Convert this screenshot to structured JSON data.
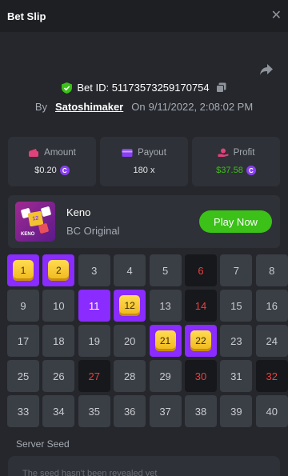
{
  "header": {
    "title": "Bet Slip",
    "close_icon": "close-icon"
  },
  "bet": {
    "id_text": "Bet ID: 51173573259170754",
    "by_label": "By",
    "author": "Satoshimaker",
    "on_label": "On",
    "datetime": "9/11/2022, 2:08:02 PM"
  },
  "stats": {
    "amount": {
      "label": "Amount",
      "value": "$0.20"
    },
    "payout": {
      "label": "Payout",
      "value": "180 x"
    },
    "profit": {
      "label": "Profit",
      "value": "$37.58"
    }
  },
  "coin_symbol": "C",
  "game": {
    "name": "Keno",
    "provider": "BC Original",
    "play_label": "Play Now",
    "thumb_tile": "12",
    "thumb_label": "KENO"
  },
  "keno": {
    "cells": [
      {
        "n": "1",
        "state": "gold"
      },
      {
        "n": "2",
        "state": "gold"
      },
      {
        "n": "3",
        "state": "normal"
      },
      {
        "n": "4",
        "state": "normal"
      },
      {
        "n": "5",
        "state": "normal"
      },
      {
        "n": "6",
        "state": "miss"
      },
      {
        "n": "7",
        "state": "normal"
      },
      {
        "n": "8",
        "state": "normal"
      },
      {
        "n": "9",
        "state": "normal"
      },
      {
        "n": "10",
        "state": "normal"
      },
      {
        "n": "11",
        "state": "hit"
      },
      {
        "n": "12",
        "state": "gold"
      },
      {
        "n": "13",
        "state": "normal"
      },
      {
        "n": "14",
        "state": "miss"
      },
      {
        "n": "15",
        "state": "normal"
      },
      {
        "n": "16",
        "state": "normal"
      },
      {
        "n": "17",
        "state": "normal"
      },
      {
        "n": "18",
        "state": "normal"
      },
      {
        "n": "19",
        "state": "normal"
      },
      {
        "n": "20",
        "state": "normal"
      },
      {
        "n": "21",
        "state": "gold"
      },
      {
        "n": "22",
        "state": "gold"
      },
      {
        "n": "23",
        "state": "normal"
      },
      {
        "n": "24",
        "state": "normal"
      },
      {
        "n": "25",
        "state": "normal"
      },
      {
        "n": "26",
        "state": "normal"
      },
      {
        "n": "27",
        "state": "miss"
      },
      {
        "n": "28",
        "state": "normal"
      },
      {
        "n": "29",
        "state": "normal"
      },
      {
        "n": "30",
        "state": "miss"
      },
      {
        "n": "31",
        "state": "normal"
      },
      {
        "n": "32",
        "state": "miss"
      },
      {
        "n": "33",
        "state": "normal"
      },
      {
        "n": "34",
        "state": "normal"
      },
      {
        "n": "35",
        "state": "normal"
      },
      {
        "n": "36",
        "state": "normal"
      },
      {
        "n": "37",
        "state": "normal"
      },
      {
        "n": "38",
        "state": "normal"
      },
      {
        "n": "39",
        "state": "normal"
      },
      {
        "n": "40",
        "state": "normal"
      }
    ]
  },
  "seed": {
    "label": "Server Seed",
    "text": "The seed hasn't been revealed yet"
  },
  "colors": {
    "background": "#25272c",
    "panel": "#2e3137",
    "accent_green": "#3bc117",
    "accent_purple": "#8a2bff",
    "miss_red": "#ed3f3f",
    "gold": "#f0b71b"
  }
}
